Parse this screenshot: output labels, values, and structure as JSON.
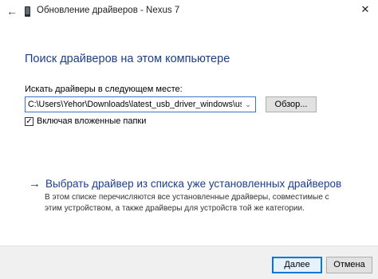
{
  "window": {
    "title": "Обновление драйверов - Nexus 7",
    "back_icon": "back-arrow-icon",
    "close_icon": "close-icon"
  },
  "main": {
    "heading": "Поиск драйверов на этом компьютере",
    "path_label": "Искать драйверы в следующем месте:",
    "path_value": "C:\\Users\\Yehor\\Downloads\\latest_usb_driver_windows\\usb_driver",
    "browse_label": "Обзор...",
    "include_subfolders_label": "Включая вложенные папки",
    "include_subfolders_checked": true,
    "pick_link": {
      "text": "Выбрать драйвер из списка уже установленных драйверов",
      "description": "В этом списке перечисляются все установленные драйверы, совместимые с этим устройством, а также драйверы для устройств той же категории."
    }
  },
  "footer": {
    "next_label": "Далее",
    "cancel_label": "Отмена"
  },
  "colors": {
    "heading": "#1c3e8a",
    "focus_border": "#0078d7"
  }
}
